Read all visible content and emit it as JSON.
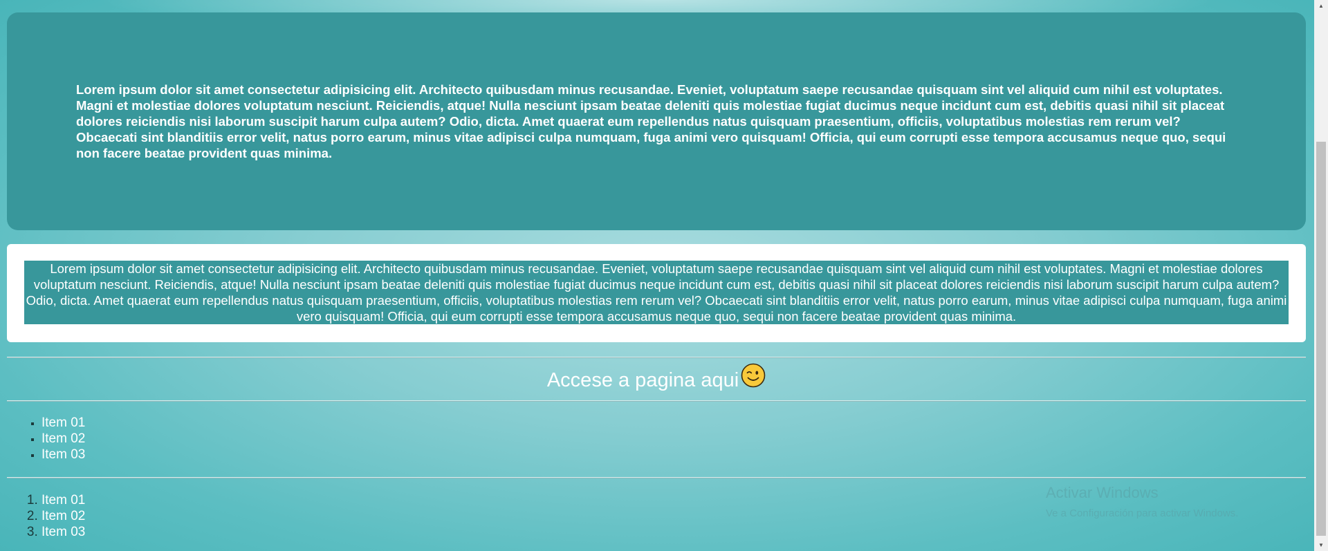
{
  "panels": {
    "top_text": "Lorem ipsum dolor sit amet consectetur adipisicing elit. Architecto quibusdam minus recusandae. Eveniet, voluptatum saepe recusandae quisquam sint vel aliquid cum nihil est voluptates. Magni et molestiae dolores voluptatum nesciunt. Reiciendis, atque! Nulla nesciunt ipsam beatae deleniti quis molestiae fugiat ducimus neque incidunt cum est, debitis quasi nihil sit placeat dolores reiciendis nisi laborum suscipit harum culpa autem? Odio, dicta. Amet quaerat eum repellendus natus quisquam praesentium, officiis, voluptatibus molestias rem rerum vel? Obcaecati sint blanditiis error velit, natus porro earum, minus vitae adipisci culpa numquam, fuga animi vero quisquam! Officia, qui eum corrupti esse tempora accusamus neque quo, sequi non facere beatae provident quas minima.",
    "middle_text": "Lorem ipsum dolor sit amet consectetur adipisicing elit. Architecto quibusdam minus recusandae. Eveniet, voluptatum saepe recusandae quisquam sint vel aliquid cum nihil est voluptates. Magni et molestiae dolores voluptatum nesciunt. Reiciendis, atque! Nulla nesciunt ipsam beatae deleniti quis molestiae fugiat ducimus neque incidunt cum est, debitis quasi nihil sit placeat dolores reiciendis nisi laborum suscipit harum culpa autem? Odio, dicta. Amet quaerat eum repellendus natus quisquam praesentium, officiis, voluptatibus molestias rem rerum vel? Obcaecati sint blanditiis error velit, natus porro earum, minus vitae adipisci culpa numquam, fuga animi vero quisquam! Officia, qui eum corrupti esse tempora accusamus neque quo, sequi non facere beatae provident quas minima."
  },
  "link": {
    "label": "Accese a pagina aqui",
    "emoji_icon": "winking-face-icon"
  },
  "unordered_list": [
    "Item 01",
    "Item 02",
    "Item 03"
  ],
  "ordered_list": [
    "Item 01",
    "Item 02",
    "Item 03"
  ],
  "watermark": {
    "title": "Activar Windows",
    "subtitle": "Ve a Configuración para activar Windows."
  },
  "colors": {
    "panel": "#38979b",
    "background": "#86cdd1",
    "text": "#ffffff"
  }
}
